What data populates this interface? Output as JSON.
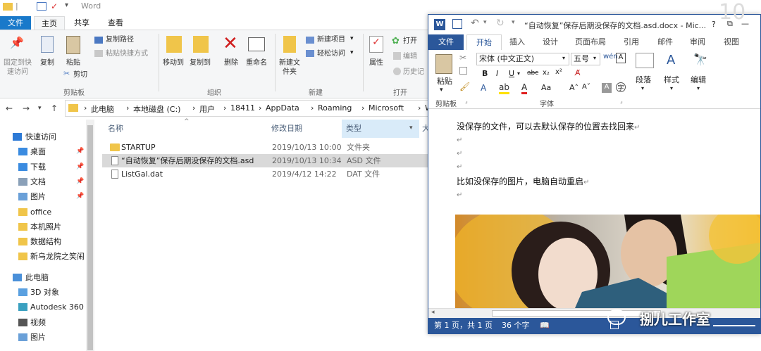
{
  "explorer": {
    "title_ghost": "Word",
    "tabs": [
      "文件",
      "主页",
      "共享",
      "查看"
    ],
    "ribbon": {
      "clipboard": {
        "pin": "固定到快速访问",
        "copy": "复制",
        "paste": "粘贴",
        "copy_path": "复制路径",
        "paste_shortcut": "粘贴快捷方式",
        "cut": "剪切",
        "group": "剪贴板"
      },
      "organize": {
        "move_to": "移动到",
        "copy_to": "复制到",
        "delete": "删除",
        "rename": "重命名",
        "group": "组织"
      },
      "new": {
        "new_item": "新建项目",
        "easy_access": "轻松访问",
        "new_folder": "新建文件夹",
        "group": "新建"
      },
      "open": {
        "properties": "属性",
        "open": "打开",
        "edit": "编辑",
        "history": "历史记",
        "group": "打开"
      }
    },
    "breadcrumbs": [
      "此电脑",
      "本地磁盘 (C:)",
      "用户",
      "18411",
      "AppData",
      "Roaming",
      "Microsoft",
      "Word"
    ],
    "nav": [
      {
        "label": "快速访问",
        "icon": "star-icon",
        "pinned": false
      },
      {
        "label": "桌面",
        "icon": "desktop-icon",
        "pinned": true
      },
      {
        "label": "下载",
        "icon": "download-icon",
        "pinned": true
      },
      {
        "label": "文档",
        "icon": "document-icon",
        "pinned": true
      },
      {
        "label": "图片",
        "icon": "picture-icon",
        "pinned": true
      },
      {
        "label": "office",
        "icon": "folder-icon",
        "pinned": false
      },
      {
        "label": "本机照片",
        "icon": "folder-icon",
        "pinned": false
      },
      {
        "label": "数据结构",
        "icon": "folder-icon",
        "pinned": false
      },
      {
        "label": "新乌龙院之笑闹",
        "icon": "folder-icon",
        "pinned": false
      },
      {
        "label": "此电脑",
        "icon": "computer-icon",
        "pinned": false
      },
      {
        "label": "3D 对象",
        "icon": "cube-icon",
        "pinned": false
      },
      {
        "label": "Autodesk 360",
        "icon": "autodesk-icon",
        "pinned": false
      },
      {
        "label": "视频",
        "icon": "video-icon",
        "pinned": false
      },
      {
        "label": "图片",
        "icon": "picture-icon",
        "pinned": false
      }
    ],
    "columns": [
      "名称",
      "修改日期",
      "类型",
      "大"
    ],
    "files": [
      {
        "name": "STARTUP",
        "date": "2019/10/13 10:00",
        "type": "文件夹",
        "icon": "folder-icon",
        "selected": false
      },
      {
        "name": "“自动恢复”保存后期没保存的文档.asd",
        "date": "2019/10/13 10:34",
        "type": "ASD 文件",
        "icon": "file-icon",
        "selected": true
      },
      {
        "name": "ListGal.dat",
        "date": "2019/4/12 14:22",
        "type": "DAT 文件",
        "icon": "file-icon",
        "selected": false
      }
    ]
  },
  "word": {
    "title": "“自动恢复”保存后期没保存的文档.asd.docx - Mic...",
    "window_controls": [
      "?",
      "⧉",
      "—",
      "☐"
    ],
    "tabs": [
      "文件",
      "开始",
      "插入",
      "设计",
      "页面布局",
      "引用",
      "邮件",
      "审阅",
      "视图"
    ],
    "ribbon": {
      "paste": "粘贴",
      "clipboard_group": "剪贴板",
      "font_name": "宋体 (中文正文)",
      "font_size": "五号",
      "font_group": "字体",
      "paragraph": "段落",
      "styles": "样式",
      "edit": "编辑"
    },
    "doc_lines": [
      "没保存的文件，可以去默认保存的位置去找回来",
      "",
      "",
      "",
      "比如没保存的图片，电脑自动重启",
      ""
    ],
    "paragraph_mark": "↵",
    "status": {
      "page": "第 1 页，共 1 页",
      "words": "36 个字"
    }
  },
  "watermark": "捌儿工作室"
}
